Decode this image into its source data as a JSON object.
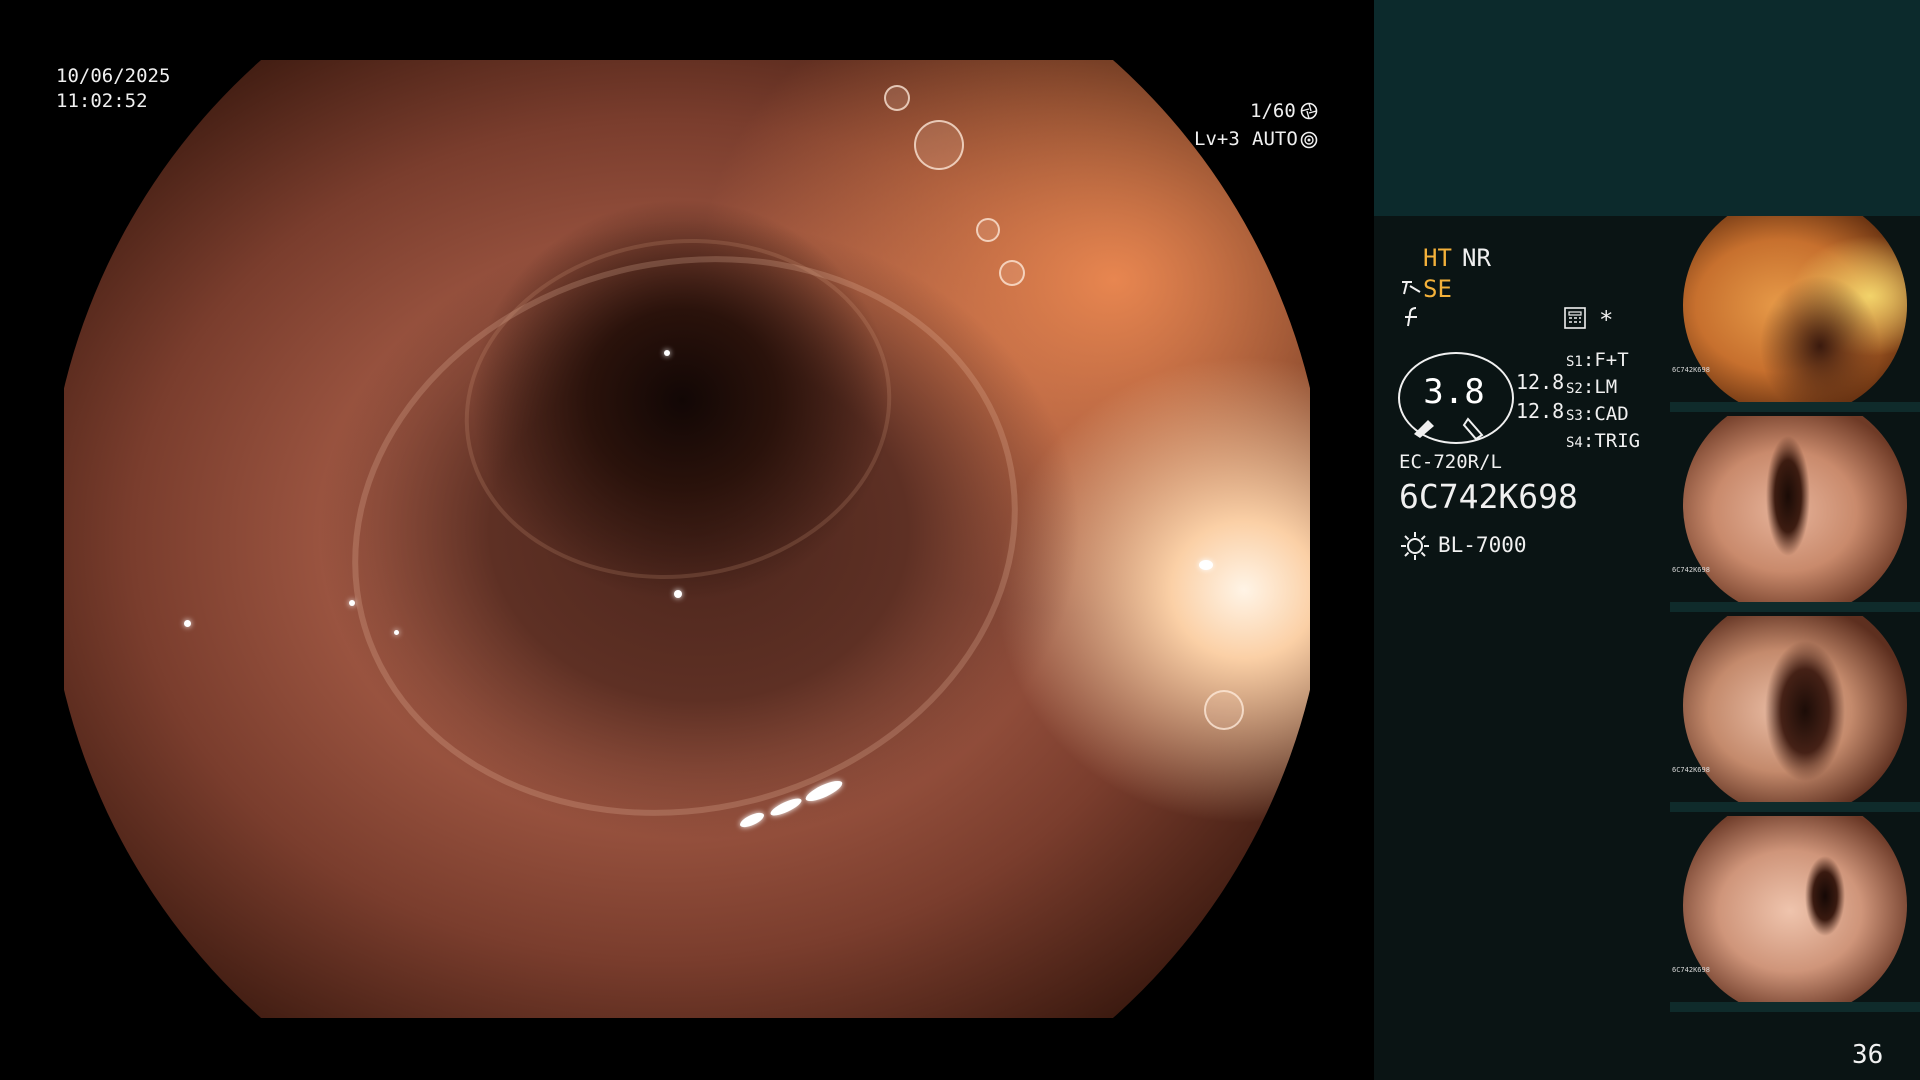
{
  "overlay": {
    "date": "10/06/2025",
    "time": "11:02:52",
    "shutter": "1/60",
    "shutter_icon": "shutter-icon",
    "level": "Lv+3",
    "exposure_mode": "AUTO",
    "exposure_icon": "iris-icon"
  },
  "status": {
    "ht": "HT",
    "nr": "NR",
    "se_prefix": "ɂ",
    "se": "SE",
    "freeze_symbol": "ƒ",
    "keypad_icon": "keypad-icon",
    "asterisk": "*"
  },
  "dial": {
    "value": "3.8",
    "line1": "12.8",
    "line2": "12.8"
  },
  "switches": [
    {
      "key": "S1",
      "value": "F+T"
    },
    {
      "key": "S2",
      "value": "LM"
    },
    {
      "key": "S3",
      "value": "CAD"
    },
    {
      "key": "S4",
      "value": "TRIG"
    }
  ],
  "scope": {
    "model": "EC-720R/L",
    "serial": "6C742K698"
  },
  "light_source": {
    "icon": "light-source-icon",
    "label": "BL-7000"
  },
  "thumbnails": [
    {
      "label": "6C742K698"
    },
    {
      "label": "6C742K698"
    },
    {
      "label": "6C742K698"
    },
    {
      "label": "6C742K698"
    }
  ],
  "frame_number": "36",
  "colors": {
    "accent_orange": "#f4b13a",
    "panel_teal": "#0c2a2c",
    "panel_dark": "#0a1414"
  }
}
